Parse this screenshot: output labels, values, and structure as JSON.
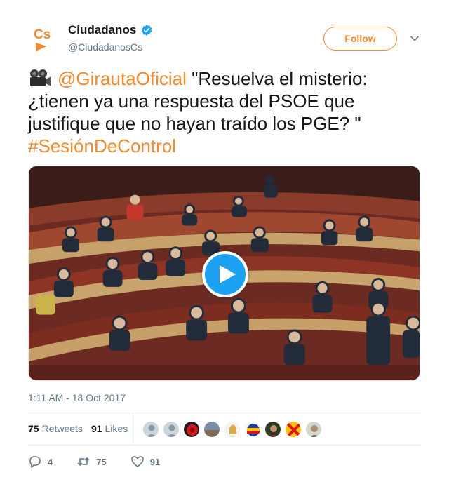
{
  "account": {
    "name": "Ciudadanos",
    "handle": "@CiudadanosCs",
    "logo_text": "Cs",
    "verified": true,
    "brand_color": "#f28a30"
  },
  "follow_button": {
    "label": "Follow"
  },
  "tweet": {
    "emoji": "movie-camera-icon",
    "mention": "@GirautaOficial",
    "body": " \"Resuelva el misterio: ¿tienen ya una respuesta del PSOE que justifique que no hayan traído los PGE? \" ",
    "hashtag": "#SesiónDeControl"
  },
  "media": {
    "type": "video",
    "play_icon": "play-icon",
    "play_color": "#1da1f2"
  },
  "timestamp": "1:11 AM - 18 Oct 2017",
  "stats": {
    "retweets_count": "75",
    "retweets_label": "Retweets",
    "likes_count": "91",
    "likes_label": "Likes"
  },
  "likers": [
    "liker-1",
    "liker-2",
    "liker-3",
    "liker-4",
    "liker-5",
    "liker-6",
    "liker-7",
    "liker-8",
    "liker-9"
  ],
  "actions": {
    "reply_count": "4",
    "retweet_count": "75",
    "like_count": "91"
  }
}
